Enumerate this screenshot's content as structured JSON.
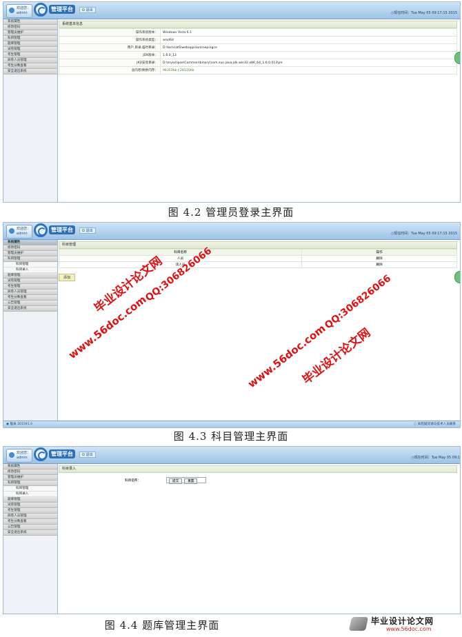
{
  "app": {
    "welcome_label": "欢迎您：",
    "username": "admin",
    "logo_text": "管理平台",
    "logout_label": "退出",
    "clock_prefix": "现在时间：",
    "clock_value_full": "Tue May 05 09:17:15 2015",
    "clock_value_cut": "Tue May 05 09:1",
    "colors": {
      "header": "#9ec3e6",
      "accent": "#2c73bf",
      "watermark": "#e01010"
    }
  },
  "figure1": {
    "menu": [
      "系统属性",
      "修改密码",
      "管理员维护",
      "科目管理",
      "题库管理",
      "试卷管理",
      "考生管理",
      "阅卷人员管理",
      "考生分数查看",
      "安全退出系统"
    ],
    "panel_title": "系统基本信息",
    "rows": [
      {
        "k": "操作系统版本：",
        "v": "Windows Vista 6.1"
      },
      {
        "k": "操作系统类型：",
        "v": "amd64"
      },
      {
        "k": "用户,目录,临时目录：",
        "v": "D:\\tomcat6\\webapps\\onlinepingce"
      },
      {
        "k": "JDK版本：",
        "v": "1.6.0_13"
      },
      {
        "k": "JKD安装目录：",
        "v": "D:\\myeclipse\\Common\\binary\\com.sun.java.jdk.win32.x86_64_1.6.0.013\\jre"
      }
    ],
    "mem_label": "总内存/剩余内存：",
    "mem_total": "98353Kb",
    "mem_sep": "/",
    "mem_free": "28135Kb",
    "caption": "图 4.2  管理员登录主界面"
  },
  "figure2": {
    "menu": [
      {
        "label": "系统属性",
        "type": "active"
      },
      {
        "label": "修改密码",
        "type": "top"
      },
      {
        "label": "管理员维护",
        "type": "top"
      },
      {
        "label": "科目管理",
        "type": "top"
      },
      {
        "label": "科目管理",
        "type": "sub"
      },
      {
        "label": "科目录入",
        "type": "sub"
      },
      {
        "label": "题库管理",
        "type": "top"
      },
      {
        "label": "试卷管理",
        "type": "top"
      },
      {
        "label": "考生管理",
        "type": "top"
      },
      {
        "label": "阅卷人员管理",
        "type": "top"
      },
      {
        "label": "考生分数查看",
        "type": "top"
      },
      {
        "label": "公告管理",
        "type": "top"
      },
      {
        "label": "安全退出系统",
        "type": "top"
      }
    ],
    "panel_title": "科目管理",
    "col_name": "科目名称",
    "col_op": "操作",
    "rows": [
      {
        "name": "人员",
        "op": "删除"
      },
      {
        "name": "读人员",
        "op": "删除"
      }
    ],
    "add_label": "添加",
    "status_left": "版本 201591.0",
    "status_right": "如有疑问请与技术人员联系",
    "caption": "图 4.3  科目管理主界面"
  },
  "figure3": {
    "menu": [
      {
        "label": "系统属性",
        "type": "top"
      },
      {
        "label": "修改密码",
        "type": "top"
      },
      {
        "label": "管理员维护",
        "type": "top"
      },
      {
        "label": "科目管理",
        "type": "top"
      },
      {
        "label": "科目管理",
        "type": "sub"
      },
      {
        "label": "科目录入",
        "type": "sub"
      },
      {
        "label": "题库管理",
        "type": "top"
      },
      {
        "label": "试卷管理",
        "type": "top"
      },
      {
        "label": "考生管理",
        "type": "top"
      },
      {
        "label": "阅卷人员管理",
        "type": "top"
      },
      {
        "label": "考生分数查看",
        "type": "top"
      },
      {
        "label": "公告管理",
        "type": "top"
      },
      {
        "label": "安全退出系统",
        "type": "top"
      }
    ],
    "panel_title": "科目录入",
    "field_label": "科目名称：",
    "submit_label": "提交",
    "reset_label": "重置",
    "caption": "图 4.4  题库管理主界面"
  },
  "watermark": {
    "site": "www.56doc.com",
    "qq": "QQ:306826066",
    "brand": "毕业设计论文网"
  },
  "footer_logo": {
    "brand": "毕业设计论文网",
    "site": "www.56doc.com"
  }
}
